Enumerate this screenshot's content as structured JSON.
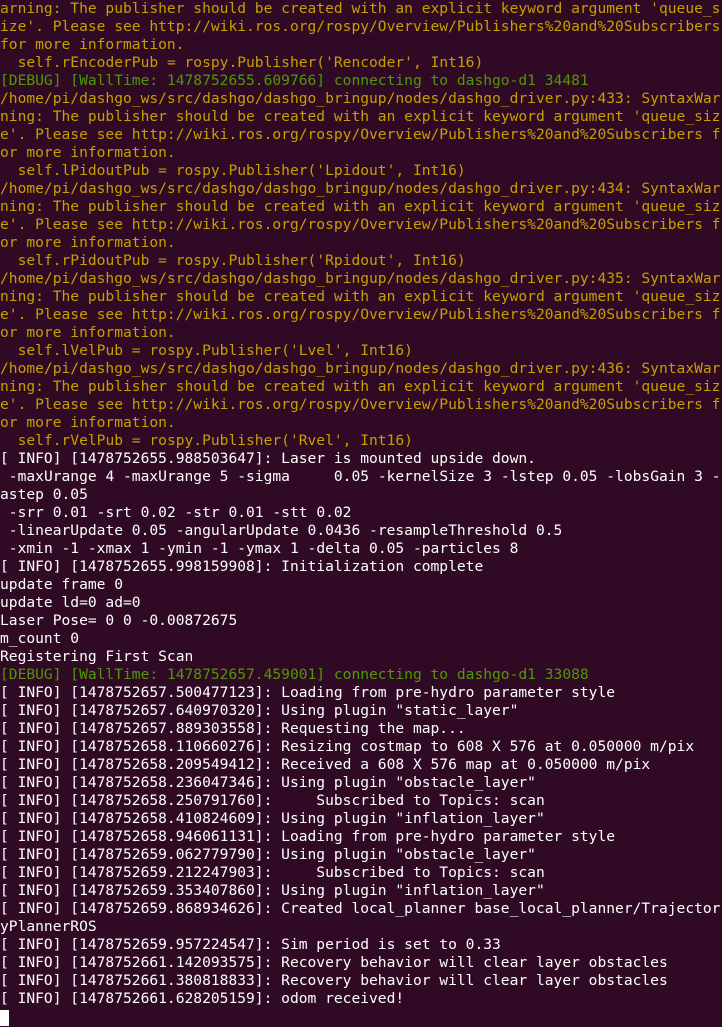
{
  "lines": [
    {
      "cls": "yellow",
      "text": "arning: The publisher should be created with an explicit keyword argument 'queue_size'. Please see http://wiki.ros.org/rospy/Overview/Publishers%20and%20Subscribers for more information."
    },
    {
      "cls": "yellow",
      "text": "  self.rEncoderPub = rospy.Publisher('Rencoder', Int16)"
    },
    {
      "cls": "green",
      "text": "[DEBUG] [WallTime: 1478752655.609766] connecting to dashgo-d1 34481"
    },
    {
      "cls": "yellow",
      "text": "/home/pi/dashgo_ws/src/dashgo/dashgo_bringup/nodes/dashgo_driver.py:433: SyntaxWarning: The publisher should be created with an explicit keyword argument 'queue_size'. Please see http://wiki.ros.org/rospy/Overview/Publishers%20and%20Subscribers for more information."
    },
    {
      "cls": "yellow",
      "text": "  self.lPidoutPub = rospy.Publisher('Lpidout', Int16)"
    },
    {
      "cls": "yellow",
      "text": "/home/pi/dashgo_ws/src/dashgo/dashgo_bringup/nodes/dashgo_driver.py:434: SyntaxWarning: The publisher should be created with an explicit keyword argument 'queue_size'. Please see http://wiki.ros.org/rospy/Overview/Publishers%20and%20Subscribers for more information."
    },
    {
      "cls": "yellow",
      "text": "  self.rPidoutPub = rospy.Publisher('Rpidout', Int16)"
    },
    {
      "cls": "yellow",
      "text": "/home/pi/dashgo_ws/src/dashgo/dashgo_bringup/nodes/dashgo_driver.py:435: SyntaxWarning: The publisher should be created with an explicit keyword argument 'queue_size'. Please see http://wiki.ros.org/rospy/Overview/Publishers%20and%20Subscribers for more information."
    },
    {
      "cls": "yellow",
      "text": "  self.lVelPub = rospy.Publisher('Lvel', Int16)"
    },
    {
      "cls": "yellow",
      "text": "/home/pi/dashgo_ws/src/dashgo/dashgo_bringup/nodes/dashgo_driver.py:436: SyntaxWarning: The publisher should be created with an explicit keyword argument 'queue_size'. Please see http://wiki.ros.org/rospy/Overview/Publishers%20and%20Subscribers for more information."
    },
    {
      "cls": "yellow",
      "text": "  self.rVelPub = rospy.Publisher('Rvel', Int16)"
    },
    {
      "cls": "",
      "text": "[ INFO] [1478752655.988503647]: Laser is mounted upside down."
    },
    {
      "cls": "",
      "text": " -maxUrange 4 -maxUrange 5 -sigma     0.05 -kernelSize 3 -lstep 0.05 -lobsGain 3 -astep 0.05"
    },
    {
      "cls": "",
      "text": " -srr 0.01 -srt 0.02 -str 0.01 -stt 0.02"
    },
    {
      "cls": "",
      "text": " -linearUpdate 0.05 -angularUpdate 0.0436 -resampleThreshold 0.5"
    },
    {
      "cls": "",
      "text": " -xmin -1 -xmax 1 -ymin -1 -ymax 1 -delta 0.05 -particles 8"
    },
    {
      "cls": "",
      "text": "[ INFO] [1478752655.998159908]: Initialization complete"
    },
    {
      "cls": "",
      "text": "update frame 0"
    },
    {
      "cls": "",
      "text": "update ld=0 ad=0"
    },
    {
      "cls": "",
      "text": "Laser Pose= 0 0 -0.00872675"
    },
    {
      "cls": "",
      "text": "m_count 0"
    },
    {
      "cls": "",
      "text": "Registering First Scan"
    },
    {
      "cls": "green",
      "text": "[DEBUG] [WallTime: 1478752657.459001] connecting to dashgo-d1 33088"
    },
    {
      "cls": "",
      "text": "[ INFO] [1478752657.500477123]: Loading from pre-hydro parameter style"
    },
    {
      "cls": "",
      "text": "[ INFO] [1478752657.640970320]: Using plugin \"static_layer\""
    },
    {
      "cls": "",
      "text": "[ INFO] [1478752657.889303558]: Requesting the map..."
    },
    {
      "cls": "",
      "text": "[ INFO] [1478752658.110660276]: Resizing costmap to 608 X 576 at 0.050000 m/pix"
    },
    {
      "cls": "",
      "text": "[ INFO] [1478752658.209549412]: Received a 608 X 576 map at 0.050000 m/pix"
    },
    {
      "cls": "",
      "text": "[ INFO] [1478752658.236047346]: Using plugin \"obstacle_layer\""
    },
    {
      "cls": "",
      "text": "[ INFO] [1478752658.250791760]:     Subscribed to Topics: scan"
    },
    {
      "cls": "",
      "text": "[ INFO] [1478752658.410824609]: Using plugin \"inflation_layer\""
    },
    {
      "cls": "",
      "text": "[ INFO] [1478752658.946061131]: Loading from pre-hydro parameter style"
    },
    {
      "cls": "",
      "text": "[ INFO] [1478752659.062779790]: Using plugin \"obstacle_layer\""
    },
    {
      "cls": "",
      "text": "[ INFO] [1478752659.212247903]:     Subscribed to Topics: scan"
    },
    {
      "cls": "",
      "text": "[ INFO] [1478752659.353407860]: Using plugin \"inflation_layer\""
    },
    {
      "cls": "",
      "text": "[ INFO] [1478752659.868934626]: Created local_planner base_local_planner/TrajectoryPlannerROS"
    },
    {
      "cls": "",
      "text": "[ INFO] [1478752659.957224547]: Sim period is set to 0.33"
    },
    {
      "cls": "",
      "text": "[ INFO] [1478752661.142093575]: Recovery behavior will clear layer obstacles"
    },
    {
      "cls": "",
      "text": "[ INFO] [1478752661.380818833]: Recovery behavior will clear layer obstacles"
    },
    {
      "cls": "",
      "text": "[ INFO] [1478752661.628205159]: odom received!"
    }
  ]
}
